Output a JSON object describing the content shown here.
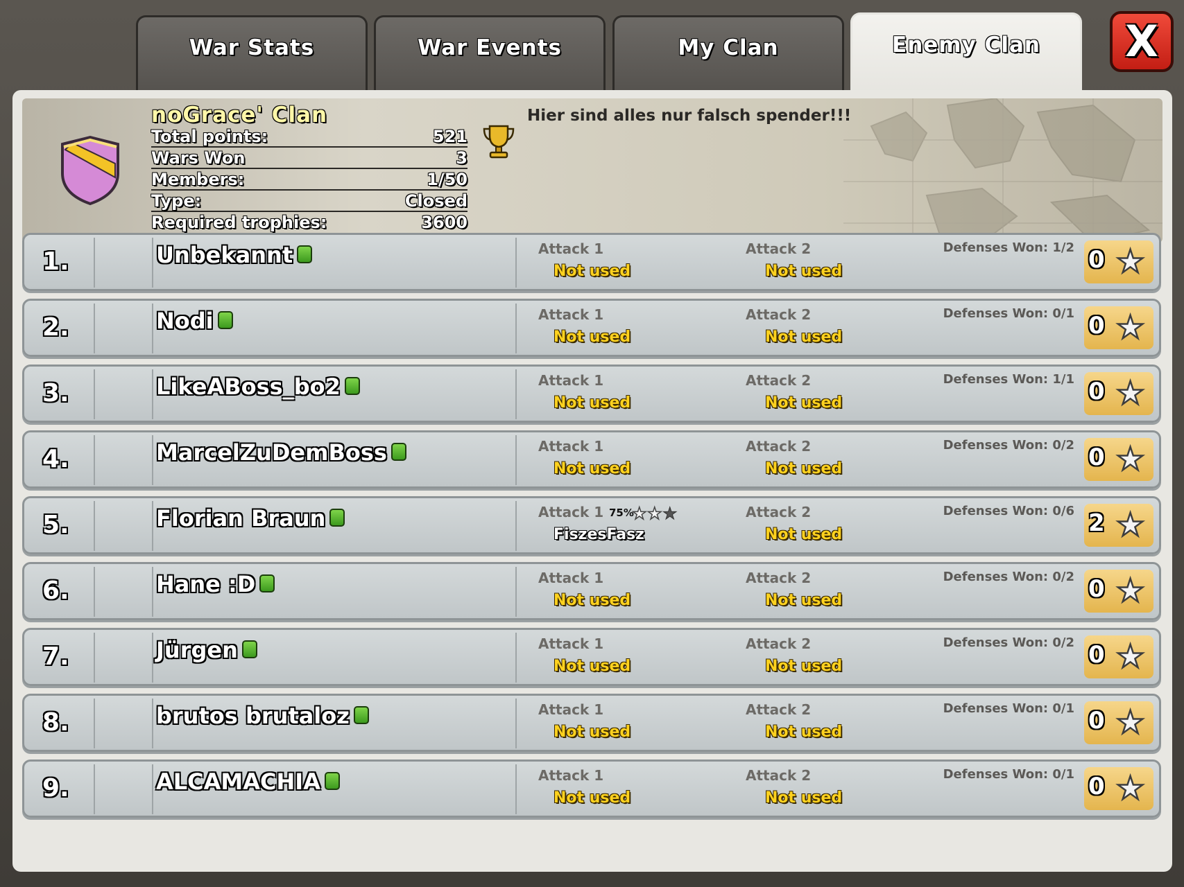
{
  "tabs": [
    {
      "label": "War Stats",
      "active": false
    },
    {
      "label": "War Events",
      "active": false
    },
    {
      "label": "My Clan",
      "active": false
    },
    {
      "label": "Enemy Clan",
      "active": true
    }
  ],
  "close_label": "X",
  "clan": {
    "name": "noGrace' Clan",
    "description": "Hier sind alles nur falsch spender!!!",
    "stats": [
      {
        "label": "Total points:",
        "value": "521"
      },
      {
        "label": "Wars Won",
        "value": "3"
      },
      {
        "label": "Members:",
        "value": "1/50"
      },
      {
        "label": "Type:",
        "value": "Closed"
      },
      {
        "label": "Required trophies:",
        "value": "3600"
      }
    ]
  },
  "colors": {
    "accent_yellow": "#ffd21f",
    "close_red": "#d8281c",
    "townhall_green": "#5ab832"
  },
  "members": [
    {
      "rank": "1.",
      "name": "Unbekannt",
      "attack1_label": "Attack 1",
      "attack1": "Not used",
      "attack2_label": "Attack 2",
      "attack2": "Not used",
      "defenses": "Defenses Won: 1/2",
      "stars": "0"
    },
    {
      "rank": "2.",
      "name": "Nodi",
      "attack1_label": "Attack 1",
      "attack1": "Not used",
      "attack2_label": "Attack 2",
      "attack2": "Not used",
      "defenses": "Defenses Won: 0/1",
      "stars": "0"
    },
    {
      "rank": "3.",
      "name": "LikeABoss_bo2",
      "attack1_label": "Attack 1",
      "attack1": "Not used",
      "attack2_label": "Attack 2",
      "attack2": "Not used",
      "defenses": "Defenses Won: 1/1",
      "stars": "0"
    },
    {
      "rank": "4.",
      "name": "MarcelZuDemBoss",
      "attack1_label": "Attack 1",
      "attack1": "Not used",
      "attack2_label": "Attack 2",
      "attack2": "Not used",
      "defenses": "Defenses Won: 0/2",
      "stars": "0"
    },
    {
      "rank": "5.",
      "name": "Florian Braun",
      "attack1_label": "Attack 1",
      "attack1": "FiszesFasz",
      "attack1_percent": "75%",
      "attack1_stars": 2,
      "attack2_label": "Attack 2",
      "attack2": "Not used",
      "defenses": "Defenses Won: 0/6",
      "stars": "2"
    },
    {
      "rank": "6.",
      "name": "Hane :D",
      "attack1_label": "Attack 1",
      "attack1": "Not used",
      "attack2_label": "Attack 2",
      "attack2": "Not used",
      "defenses": "Defenses Won: 0/2",
      "stars": "0"
    },
    {
      "rank": "7.",
      "name": "Jürgen",
      "attack1_label": "Attack 1",
      "attack1": "Not used",
      "attack2_label": "Attack 2",
      "attack2": "Not used",
      "defenses": "Defenses Won: 0/2",
      "stars": "0"
    },
    {
      "rank": "8.",
      "name": "brutos brutaloz",
      "attack1_label": "Attack 1",
      "attack1": "Not used",
      "attack2_label": "Attack 2",
      "attack2": "Not used",
      "defenses": "Defenses Won: 0/1",
      "stars": "0"
    },
    {
      "rank": "9.",
      "name": "ALCAMACHIA",
      "attack1_label": "Attack 1",
      "attack1": "Not used",
      "attack2_label": "Attack 2",
      "attack2": "Not used",
      "defenses": "Defenses Won: 0/1",
      "stars": "0"
    }
  ]
}
